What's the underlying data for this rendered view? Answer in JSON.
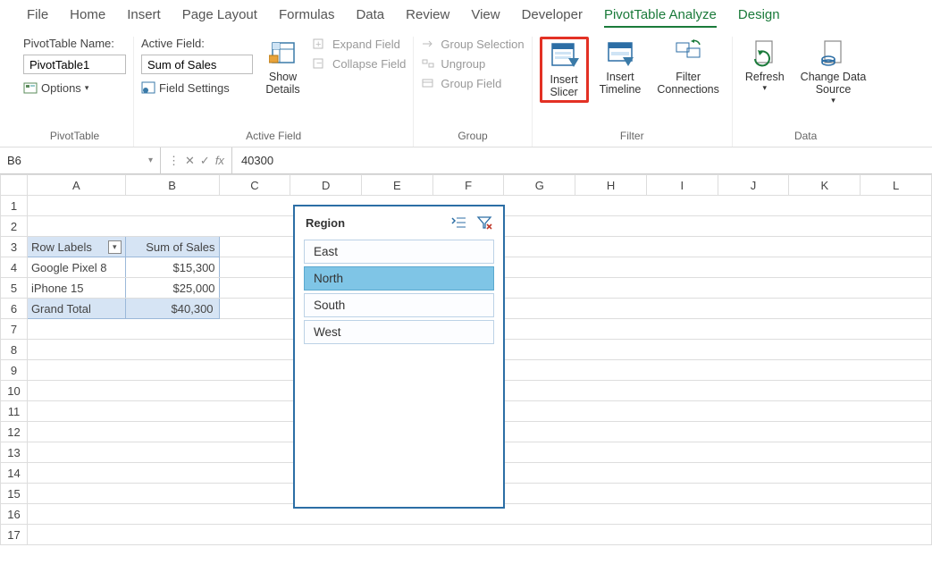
{
  "tabs": [
    "File",
    "Home",
    "Insert",
    "Page Layout",
    "Formulas",
    "Data",
    "Review",
    "View",
    "Developer",
    "PivotTable Analyze",
    "Design"
  ],
  "activeTab": "PivotTable Analyze",
  "ribbon": {
    "pivottable": {
      "nameLabel": "PivotTable Name:",
      "nameValue": "PivotTable1",
      "options": "Options",
      "groupLabel": "PivotTable"
    },
    "activeField": {
      "label": "Active Field:",
      "value": "Sum of Sales",
      "fieldSettings": "Field Settings",
      "showDetails": "Show\nDetails",
      "expand": "Expand Field",
      "collapse": "Collapse Field",
      "groupLabel": "Active Field"
    },
    "group": {
      "selection": "Group Selection",
      "ungroup": "Ungroup",
      "field": "Group Field",
      "groupLabel": "Group"
    },
    "filter": {
      "insertSlicer": "Insert\nSlicer",
      "insertTimeline": "Insert\nTimeline",
      "filterConnections": "Filter\nConnections",
      "groupLabel": "Filter"
    },
    "data": {
      "refresh": "Refresh",
      "changeDataSource": "Change Data\nSource",
      "groupLabel": "Data"
    }
  },
  "formulaBar": {
    "nameBox": "B6",
    "fx": "fx",
    "value": "40300"
  },
  "columns": [
    "A",
    "B",
    "C",
    "D",
    "E",
    "F",
    "G",
    "H",
    "I",
    "J",
    "K",
    "L"
  ],
  "pivot": {
    "rowLabelsHeader": "Row Labels",
    "valuesHeader": "Sum of Sales",
    "rows": [
      {
        "label": "Google Pixel 8",
        "value": "$15,300"
      },
      {
        "label": "iPhone 15",
        "value": "$25,000"
      }
    ],
    "grandLabel": "Grand Total",
    "grandValue": "$40,300"
  },
  "slicer": {
    "title": "Region",
    "items": [
      "East",
      "North",
      "South",
      "West"
    ],
    "selected": "North"
  },
  "chart_data": {
    "type": "table",
    "title": "Sum of Sales by Row Labels",
    "columns": [
      "Row Labels",
      "Sum of Sales"
    ],
    "rows": [
      [
        "Google Pixel 8",
        15300
      ],
      [
        "iPhone 15",
        25000
      ],
      [
        "Grand Total",
        40300
      ]
    ]
  }
}
